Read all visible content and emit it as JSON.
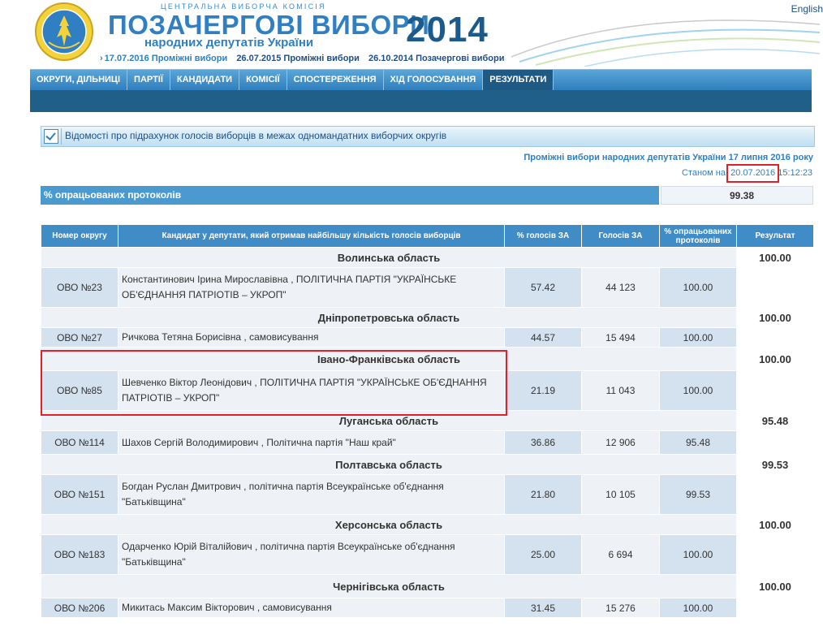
{
  "header": {
    "cec": "ЦЕНТРАЛЬНА ВИБОРЧА КОМІСІЯ",
    "title": "ПОЗАЧЕРГОВІ ВИБОРИ",
    "subtitle": "народних депутатів України",
    "year": "2014",
    "english": "English",
    "links": [
      {
        "label": "17.07.2016 Проміжні вибори"
      },
      {
        "label": "26.07.2015 Проміжні вибори"
      },
      {
        "label": "26.10.2014 Позачергові вибори"
      }
    ],
    "brand_color": "#2f7fc2"
  },
  "nav": [
    "ОКРУГИ, ДІЛЬНИЦІ",
    "ПАРТІЇ",
    "КАНДИДАТИ",
    "КОМІСІЇ",
    "СПОСТЕРЕЖЕННЯ",
    "ХІД ГОЛОСУВАННЯ",
    "РЕЗУЛЬТАТИ"
  ],
  "nav_active": "РЕЗУЛЬТАТИ",
  "panel_title": "Відомості про підрахунок голосів виборців в межах одномандатних виборчих округів",
  "election_subtitle": "Проміжні вибори народних депутатів України 17 липня 2016 року",
  "as_of": {
    "label": "Станом на",
    "date": "20.07.2016",
    "time": "15:12:23"
  },
  "processed": {
    "label": "% опрацьованих протоколів",
    "value": "99.38"
  },
  "table": {
    "headers": [
      "Номер округу",
      "Кандидат у депутати, який отримав найбільшу кількість голосів виборців",
      "% голосів ЗА",
      "Голосів ЗА",
      "% опрацьованих протоколів",
      "Результат"
    ],
    "regions": [
      {
        "name": "Волинська область",
        "result": "100.00",
        "rows": [
          {
            "district": "ОВО №23",
            "candidate": "Константинович Ірина Мирославівна , ПОЛІТИЧНА ПАРТІЯ \"УКРАЇНСЬКЕ ОБ'ЄДНАННЯ ПАТРІОТІВ – УКРОП\"",
            "pct": "57.42",
            "votes": "44 123",
            "processed": "100.00"
          }
        ]
      },
      {
        "name": "Дніпропетровська область",
        "result": "100.00",
        "rows": [
          {
            "district": "ОВО №27",
            "candidate": "Ричкова Тетяна Борисівна , самовисування",
            "pct": "44.57",
            "votes": "15 494",
            "processed": "100.00"
          }
        ]
      },
      {
        "name": "Івано-Франківська область",
        "result": "100.00",
        "rows": [
          {
            "district": "ОВО №85",
            "candidate": "Шевченко Віктор Леонідович , ПОЛІТИЧНА ПАРТІЯ \"УКРАЇНСЬКЕ ОБ'ЄДНАННЯ ПАТРІОТІВ – УКРОП\"",
            "pct": "21.19",
            "votes": "11 043",
            "processed": "100.00"
          }
        ]
      },
      {
        "name": "Луганська область",
        "result": "95.48",
        "rows": [
          {
            "district": "ОВО №114",
            "candidate": "Шахов Сергій Володимирович , Політична партія \"Наш край\"",
            "pct": "36.86",
            "votes": "12 906",
            "processed": "95.48"
          }
        ]
      },
      {
        "name": "Полтавська область",
        "result": "99.53",
        "rows": [
          {
            "district": "ОВО №151",
            "candidate": "Богдан Руслан Дмитрович , політична партія Всеукраїнське об'єднання \"Батьківщина\"",
            "pct": "21.80",
            "votes": "10 105",
            "processed": "99.53"
          }
        ]
      },
      {
        "name": "Херсонська область",
        "result": "100.00",
        "rows": [
          {
            "district": "ОВО №183",
            "candidate": "Одарченко Юрій Віталійович , політична партія Всеукраїнське об'єднання \"Батьківщина\"",
            "pct": "25.00",
            "votes": "6 694",
            "processed": "100.00"
          }
        ]
      },
      {
        "name": "Чернігівська область",
        "result": "100.00",
        "rows": [
          {
            "district": "ОВО №206",
            "candidate": "Микитась Максим Вікторович , самовисування",
            "pct": "31.45",
            "votes": "15 276",
            "processed": "100.00"
          }
        ]
      }
    ]
  }
}
